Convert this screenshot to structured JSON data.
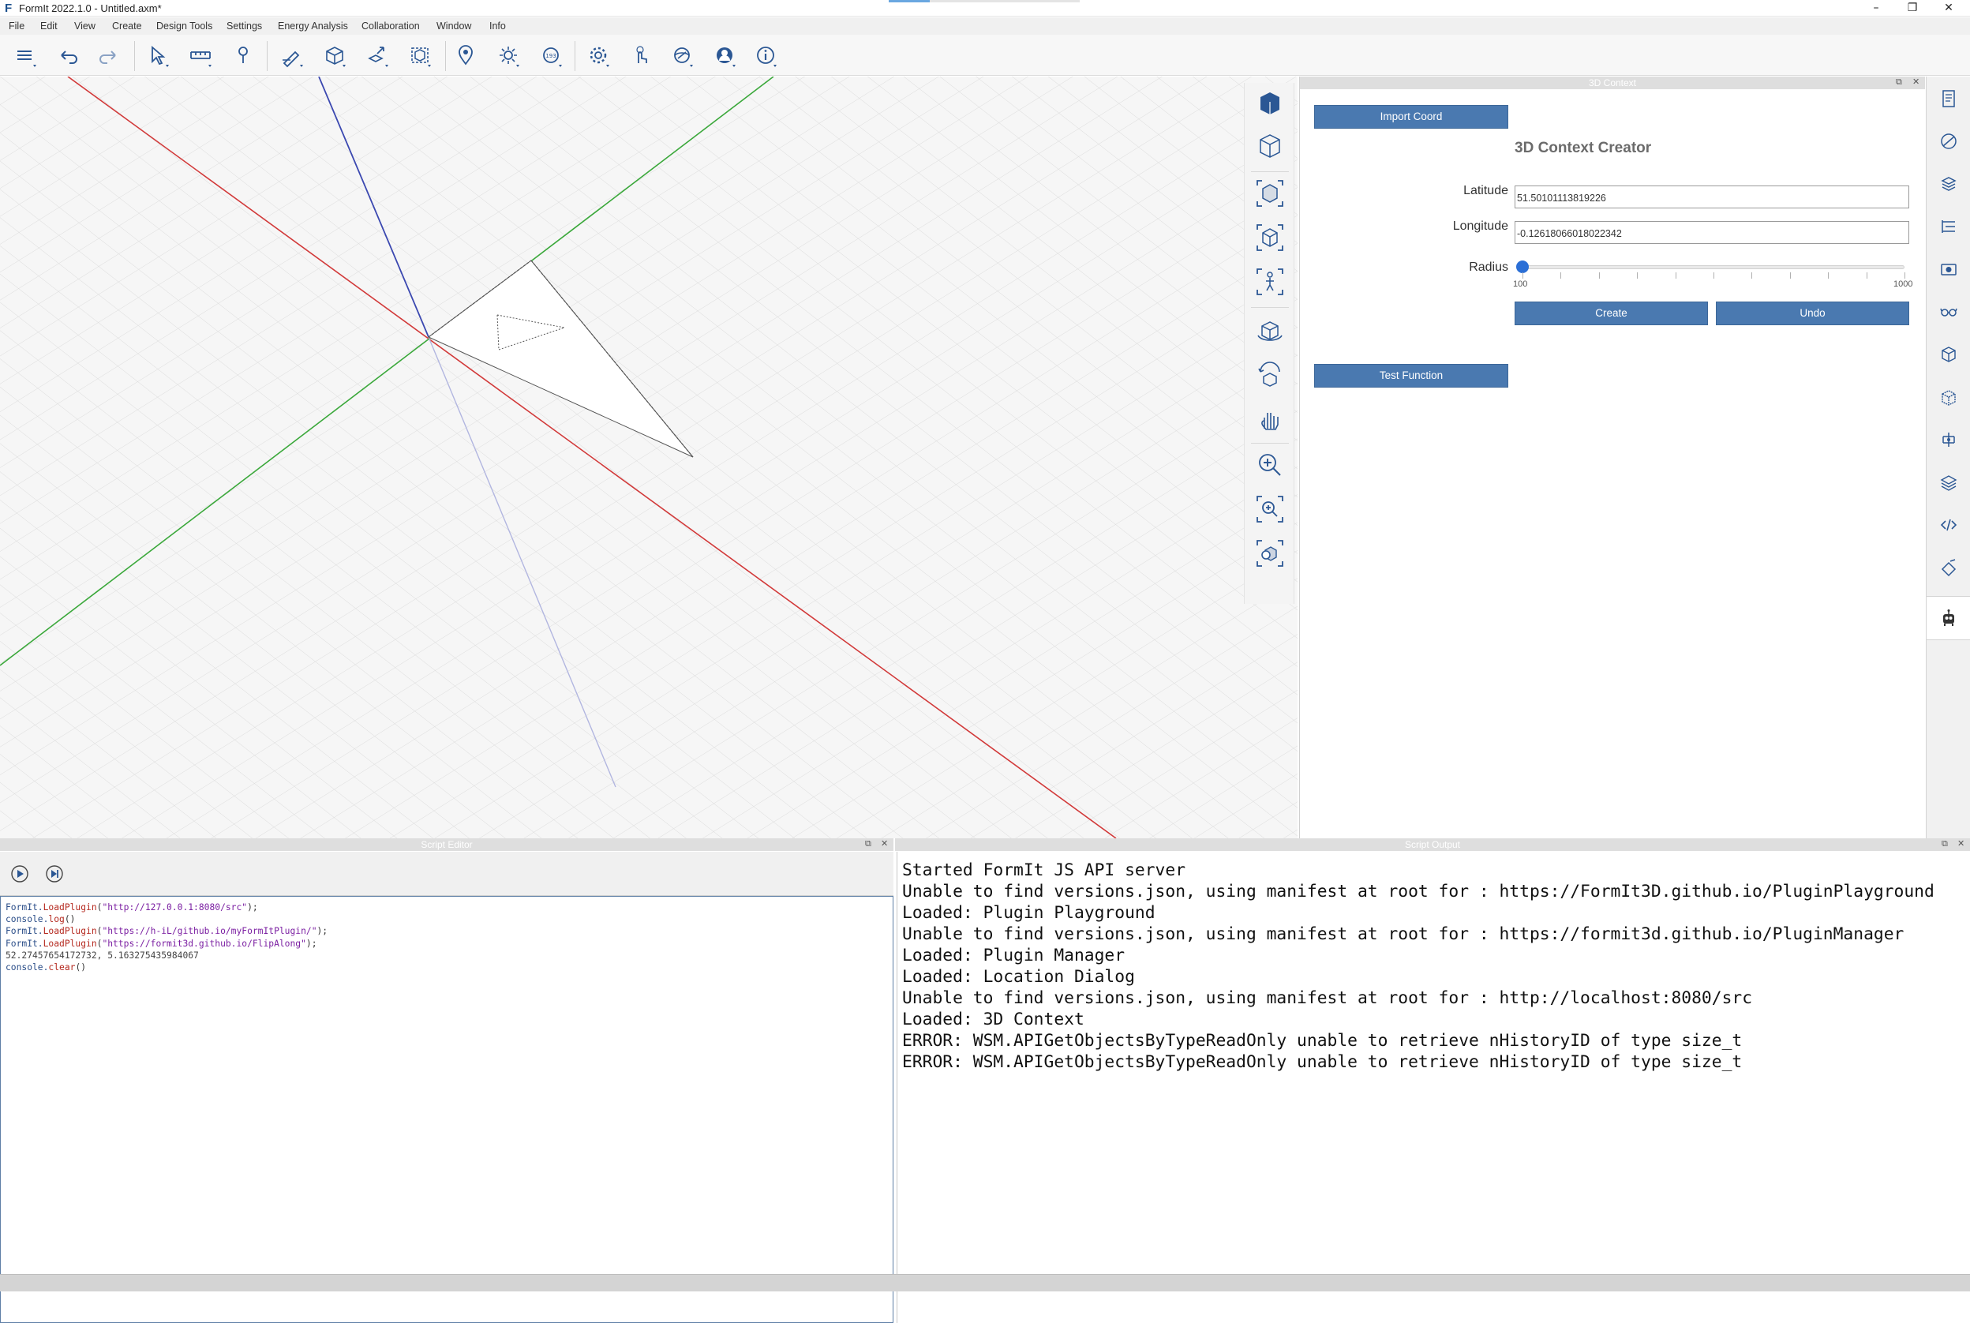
{
  "window": {
    "title": "FormIt 2022.1.0 - Untitled.axm*",
    "logo_letter": "F",
    "minimize": "–",
    "restore": "❐",
    "close": "✕"
  },
  "menu": [
    "File",
    "Edit",
    "View",
    "Create",
    "Design Tools",
    "Settings",
    "Energy Analysis",
    "Collaboration",
    "Window",
    "Info"
  ],
  "toolbar": {
    "tools": [
      "layers-icon",
      "undo-icon",
      "redo-icon",
      "select-icon",
      "measure-icon",
      "paint-icon",
      "sketch-icon",
      "solid-icon",
      "manipulate-icon",
      "group-icon",
      "location-icon",
      "sun-icon",
      "sun-path-icon",
      "settings-icon",
      "touch-icon",
      "view-icon",
      "user-icon",
      "info-icon"
    ]
  },
  "nav_tools": [
    "perspective-cube-icon",
    "orbit-cube-icon",
    "zoom-selection-icon",
    "cube-view-icon",
    "walk-icon",
    "orbit-icon",
    "look-around-icon",
    "pan-hand-icon",
    "zoom-icon",
    "zoom-region-icon",
    "zoom-fit-icon"
  ],
  "context_panel": {
    "header": "3D Context",
    "import_button": "Import Coord",
    "title": "3D Context Creator",
    "latitude_label": "Latitude",
    "latitude_value": "51.50101113819226",
    "longitude_label": "Longitude",
    "longitude_value": "-0.12618066018022342",
    "radius_label": "Radius",
    "radius_min": "100",
    "radius_max": "1000",
    "radius_value": 100,
    "create_button": "Create",
    "undo_button": "Undo",
    "test_button": "Test Function",
    "dock_icon": "⧉",
    "close_icon": "✕"
  },
  "right_strip": [
    "properties-icon",
    "materials-icon",
    "layers-panel-icon",
    "levels-icon",
    "scenes-icon",
    "visual-style-icon",
    "groups-icon",
    "components-icon",
    "hierarchy-icon",
    "stack-icon",
    "code-icon",
    "fill-icon",
    "plugin-robot-icon"
  ],
  "script_editor": {
    "header": "Script Editor",
    "run_icon": "play-icon",
    "step_icon": "step-icon",
    "lines": [
      [
        {
          "t": "FormIt.",
          "c": "obj"
        },
        {
          "t": "LoadPlugin",
          "c": "fn"
        },
        {
          "t": "(",
          "c": "plain"
        },
        {
          "t": "\"http://127.0.0.1:8080/src\"",
          "c": "str"
        },
        {
          "t": ");",
          "c": "plain"
        }
      ],
      [
        {
          "t": "console.",
          "c": "obj"
        },
        {
          "t": "log",
          "c": "fn"
        },
        {
          "t": "()",
          "c": "plain"
        }
      ],
      [
        {
          "t": "FormIt.",
          "c": "obj"
        },
        {
          "t": "LoadPlugin",
          "c": "fn"
        },
        {
          "t": "(",
          "c": "plain"
        },
        {
          "t": "\"https://h-iL/github.io/myFormItPlugin/\"",
          "c": "str"
        },
        {
          "t": ");",
          "c": "plain"
        }
      ],
      [
        {
          "t": "FormIt.",
          "c": "obj"
        },
        {
          "t": "LoadPlugin",
          "c": "fn"
        },
        {
          "t": "(",
          "c": "plain"
        },
        {
          "t": "\"https://formit3d.github.io/FlipAlong\"",
          "c": "str"
        },
        {
          "t": ");",
          "c": "plain"
        }
      ],
      [
        {
          "t": "52.27457654172732, 5.163275435984067",
          "c": "num"
        }
      ],
      [
        {
          "t": "console.",
          "c": "obj"
        },
        {
          "t": "clear",
          "c": "fn"
        },
        {
          "t": "()",
          "c": "plain"
        }
      ]
    ]
  },
  "script_output": {
    "header": "Script Output",
    "lines": [
      "Started FormIt JS API server",
      "Unable to find versions.json, using manifest at root for : https://FormIt3D.github.io/PluginPlayground",
      "Loaded: Plugin Playground",
      "Unable to find versions.json, using manifest at root for : https://formit3d.github.io/PluginManager",
      "Loaded: Plugin Manager",
      "Loaded: Location Dialog",
      "Unable to find versions.json, using manifest at root for : http://localhost:8080/src",
      "Loaded: 3D Context",
      "ERROR: WSM.APIGetObjectsByTypeReadOnly unable to retrieve nHistoryID of type size_t",
      "ERROR: WSM.APIGetObjectsByTypeReadOnly unable to retrieve nHistoryID of type size_t"
    ]
  },
  "colors": {
    "accent_blue": "#4a79b0",
    "x_axis": "#d23a3a",
    "y_axis": "#3ba83b",
    "z_axis": "#3b48b0"
  }
}
